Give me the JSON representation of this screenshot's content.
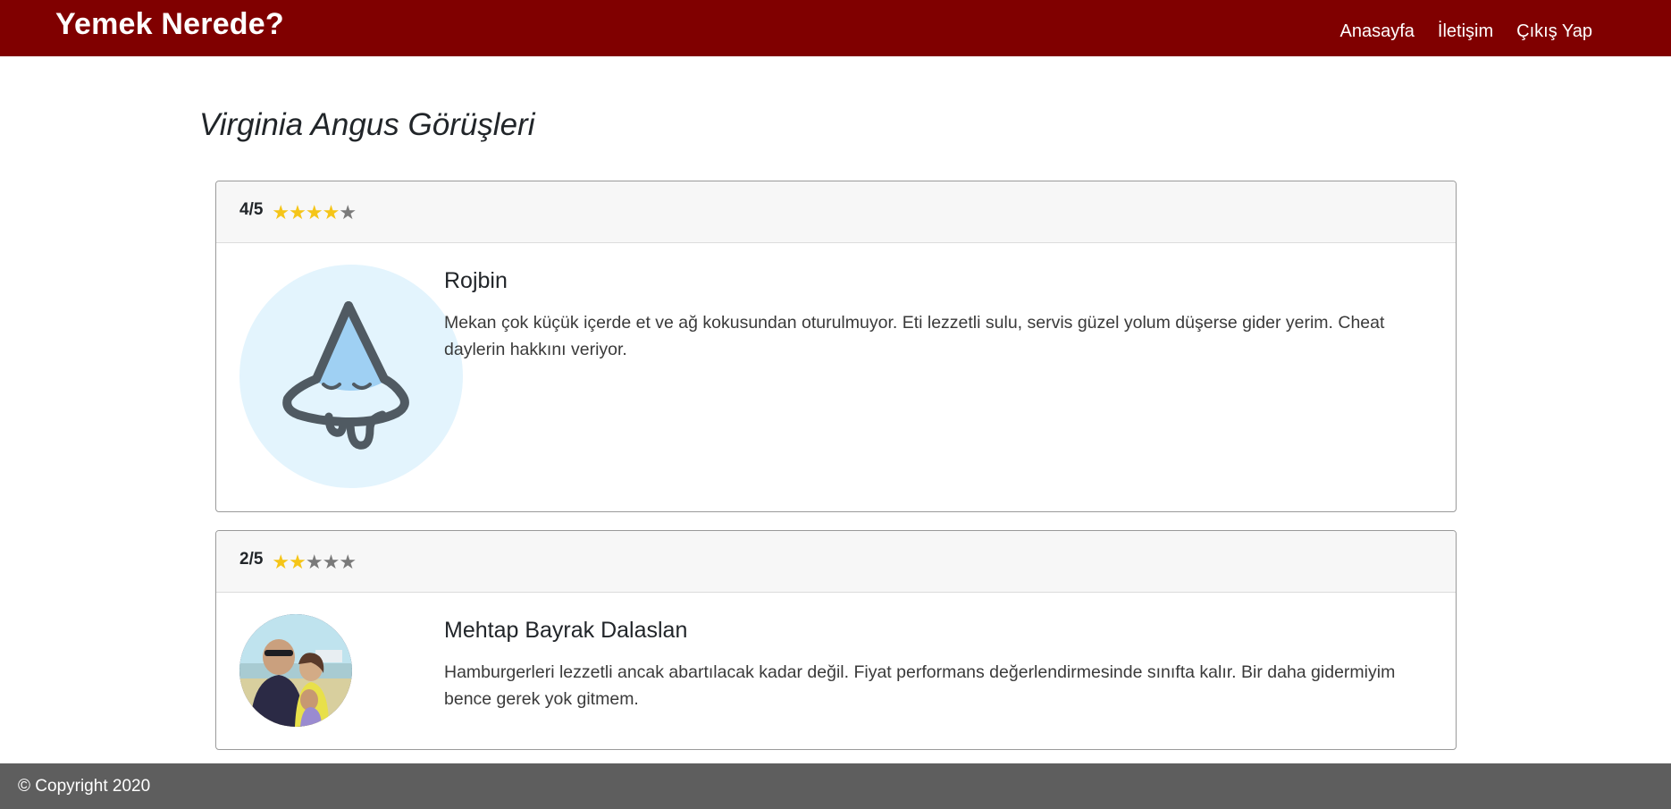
{
  "navbar": {
    "brand": "Yemek Nerede?",
    "links": [
      "Anasayfa",
      "İletişim",
      "Çıkış Yap"
    ]
  },
  "page": {
    "title": "Virginia Angus Görüşleri"
  },
  "reviews": [
    {
      "rating_text": "4/5",
      "rating": 4,
      "max_rating": 5,
      "author": "Rojbin",
      "text": "Mekan çok küçük içerde et ve ağ kokusundan oturulmuyor. Eti lezzetli sulu, servis güzel yolum düşerse gider yerim. Cheat daylerin hakkını veriyor.",
      "avatar_icon": "pizza-slice-avatar-icon"
    },
    {
      "rating_text": "2/5",
      "rating": 2,
      "max_rating": 5,
      "author": "Mehtap Bayrak Dalaslan",
      "text": "Hamburgerleri lezzetli ancak abartılacak kadar değil. Fiyat performans değerlendirmesinde sınıfta kalır. Bir daha gidermiyim bence gerek yok gitmem.",
      "avatar_icon": "profile-photo"
    }
  ],
  "footer": {
    "copyright": "© Copyright 2020"
  },
  "colors": {
    "navbar": "#800000",
    "footer": "#5e5e5e",
    "star_on": "#f5c518",
    "star_off": "#7a7a7a"
  }
}
